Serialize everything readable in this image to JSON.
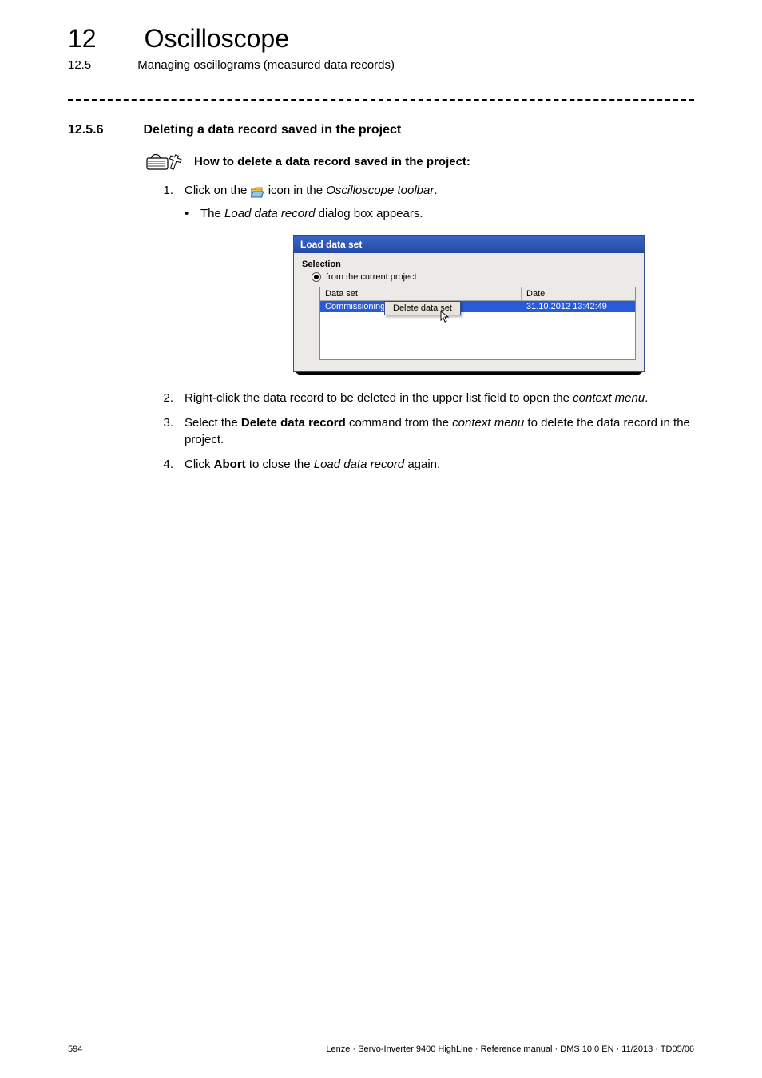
{
  "header": {
    "chapter_number": "12",
    "chapter_title": "Oscilloscope",
    "section_number": "12.5",
    "section_title": "Managing oscillograms (measured data records)"
  },
  "section": {
    "number": "12.5.6",
    "title": "Deleting a data record saved in the project"
  },
  "howto": "How to delete a data record saved in the project:",
  "steps": {
    "s1": {
      "num": "1.",
      "pre": "Click on the ",
      "post": " icon in the ",
      "ref": "Oscilloscope toolbar",
      "tail": "."
    },
    "s1b": {
      "pre": "The ",
      "ref": "Load data record",
      "post": " dialog box appears."
    },
    "s2": {
      "num": "2.",
      "pre": "Right-click the data record to be deleted in the upper list field to open the ",
      "ref": "context menu",
      "post": "."
    },
    "s3": {
      "num": "3.",
      "pre": "Select the ",
      "bold": "Delete data record",
      "mid": " command from the ",
      "ref": "context menu",
      "post": " to delete the data record in the project."
    },
    "s4": {
      "num": "4.",
      "pre": "Click ",
      "bold": "Abort",
      "mid": " to close the ",
      "ref": "Load data record",
      "post": " again."
    }
  },
  "dialog": {
    "title": "Load data set",
    "selection_label": "Selection",
    "radio_label": "from the current project",
    "columns": {
      "c1": "Data set",
      "c2": "Date"
    },
    "row": {
      "name": "Commissioning",
      "date": "31.10.2012 13:42:49"
    },
    "context_menu": "Delete data set"
  },
  "footer": {
    "page": "594",
    "meta": "Lenze · Servo-Inverter 9400 HighLine · Reference manual · DMS 10.0 EN · 11/2013 · TD05/06"
  },
  "bullet_char": "•"
}
